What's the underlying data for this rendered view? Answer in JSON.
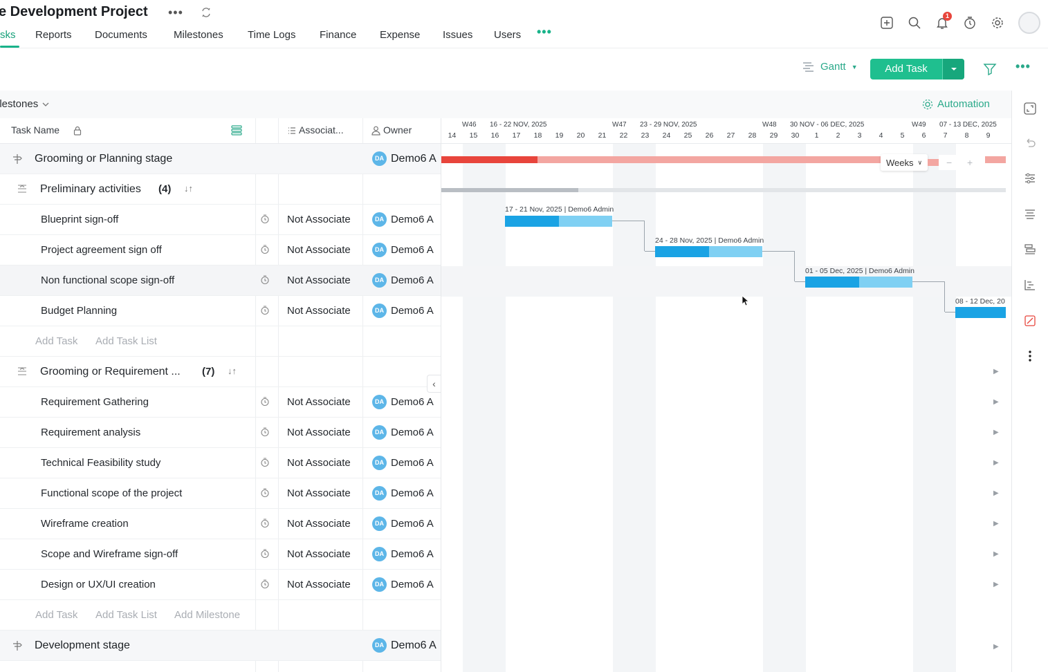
{
  "header": {
    "project_title": "e Development Project",
    "nav_tabs": [
      "sks",
      "Reports",
      "Documents",
      "Milestones",
      "Time Logs",
      "Finance",
      "Expense",
      "Issues",
      "Users"
    ],
    "notification_count": "1"
  },
  "toolbar": {
    "view_label": "Gantt",
    "add_task_label": "Add Task"
  },
  "filter_bar": {
    "milestones_label": "ilestones",
    "automation_label": "Automation"
  },
  "columns": {
    "task_name": "Task Name",
    "associated": "Associat...",
    "owner": "Owner"
  },
  "avatar_initials": "DA",
  "rows": [
    {
      "name": "Grooming or Planning stage",
      "owner": "Demo6 A"
    },
    {
      "name": "Preliminary activities",
      "count": "(4)"
    },
    {
      "name": "Blueprint sign-off",
      "assoc": "Not Associate",
      "owner": "Demo6 A"
    },
    {
      "name": "Project agreement sign off",
      "assoc": "Not Associate",
      "owner": "Demo6 A"
    },
    {
      "name": "Non functional scope sign-off",
      "assoc": "Not Associate",
      "owner": "Demo6 A"
    },
    {
      "name": "Budget Planning",
      "assoc": "Not Associate",
      "owner": "Demo6 A"
    },
    {
      "add_task": "Add Task",
      "add_task_list": "Add Task List"
    },
    {
      "name": "Grooming or Requirement ...",
      "count": "(7)"
    },
    {
      "name": "Requirement Gathering",
      "assoc": "Not Associate",
      "owner": "Demo6 A"
    },
    {
      "name": "Requirement analysis",
      "assoc": "Not Associate",
      "owner": "Demo6 A"
    },
    {
      "name": "Technical Feasibility study",
      "assoc": "Not Associate",
      "owner": "Demo6 A"
    },
    {
      "name": "Functional scope of the project",
      "assoc": "Not Associate",
      "owner": "Demo6 A"
    },
    {
      "name": "Wireframe creation",
      "assoc": "Not Associate",
      "owner": "Demo6 A"
    },
    {
      "name": "Scope and Wireframe sign-off",
      "assoc": "Not Associate",
      "owner": "Demo6 A"
    },
    {
      "name": "Design or UX/UI creation",
      "assoc": "Not Associate",
      "owner": "Demo6 A"
    },
    {
      "add_task": "Add Task",
      "add_task_list": "Add Task List",
      "add_milestone": "Add Milestone"
    },
    {
      "name": "Development stage",
      "owner": "Demo6 A"
    }
  ],
  "gantt": {
    "weeks": [
      {
        "code": "W46",
        "range": "16 - 22 NOV, 2025"
      },
      {
        "code": "W47",
        "range": "23 - 29 NOV, 2025"
      },
      {
        "code": "W48",
        "range": "30 NOV - 06 DEC, 2025"
      },
      {
        "code": "W49",
        "range": "07 - 13 DEC, 2025"
      }
    ],
    "days": [
      "14",
      "15",
      "16",
      "17",
      "18",
      "19",
      "20",
      "21",
      "22",
      "23",
      "24",
      "25",
      "26",
      "27",
      "28",
      "29",
      "30",
      "1",
      "2",
      "3",
      "4",
      "5",
      "6",
      "7",
      "8",
      "9"
    ],
    "zoom_label": "Weeks",
    "zoom_minus": "−",
    "zoom_plus": "+",
    "bar_labels": [
      "17 - 21 Nov, 2025 | Demo6 Admin",
      "24 - 28 Nov, 2025 | Demo6 Admin",
      "01 - 05 Dec, 2025 | Demo6 Admin",
      "08 - 12 Dec, 20"
    ],
    "colors": {
      "milestone_done": "#e8453c",
      "milestone_rest": "#f3a6a1",
      "task_done": "#1aa3e4",
      "task_rest": "#7fd0f3",
      "accent": "#1fbf8f"
    }
  }
}
